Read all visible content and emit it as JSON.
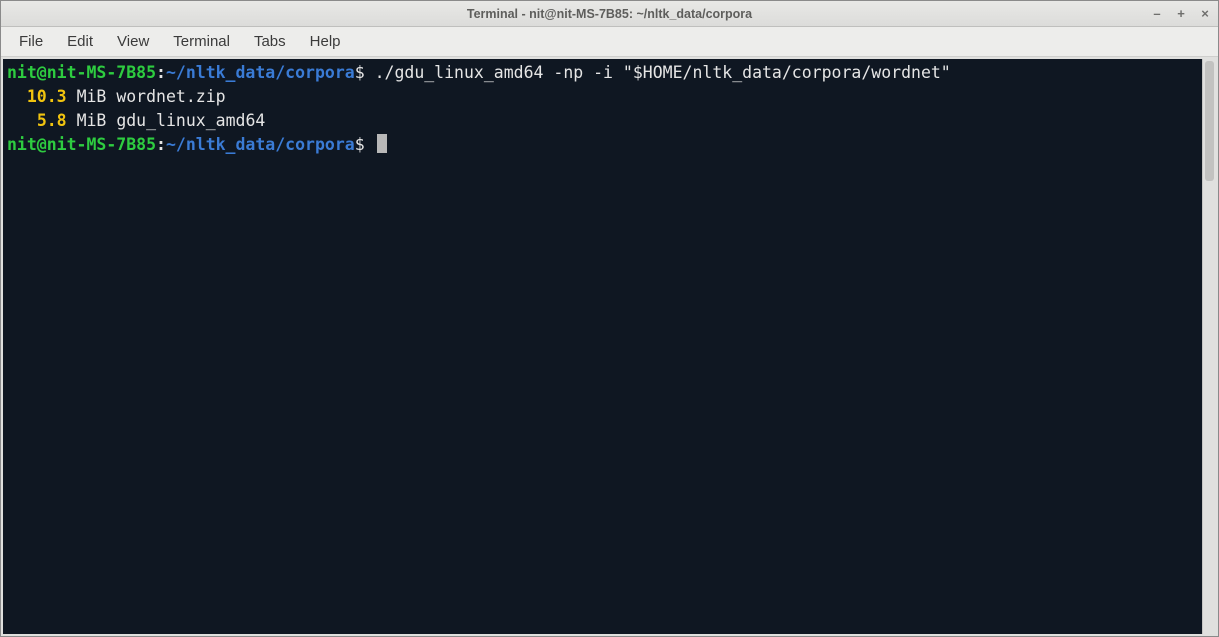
{
  "window": {
    "title": "Terminal - nit@nit-MS-7B85: ~/nltk_data/corpora"
  },
  "menubar": {
    "items": [
      "File",
      "Edit",
      "View",
      "Terminal",
      "Tabs",
      "Help"
    ]
  },
  "terminal": {
    "prompt": {
      "userhost": "nit@nit-MS-7B85",
      "colon": ":",
      "path": "~/nltk_data/corpora",
      "symbol": "$"
    },
    "command": "./gdu_linux_amd64 -np -i \"$HOME/nltk_data/corpora/wordnet\"",
    "output": [
      {
        "size": "10.3",
        "unit": "MiB",
        "name": "wordnet.zip"
      },
      {
        "size": "5.8",
        "unit": "MiB",
        "name": "gdu_linux_amd64"
      }
    ]
  },
  "controls": {
    "minimize": "–",
    "maximize": "+",
    "close": "×"
  }
}
